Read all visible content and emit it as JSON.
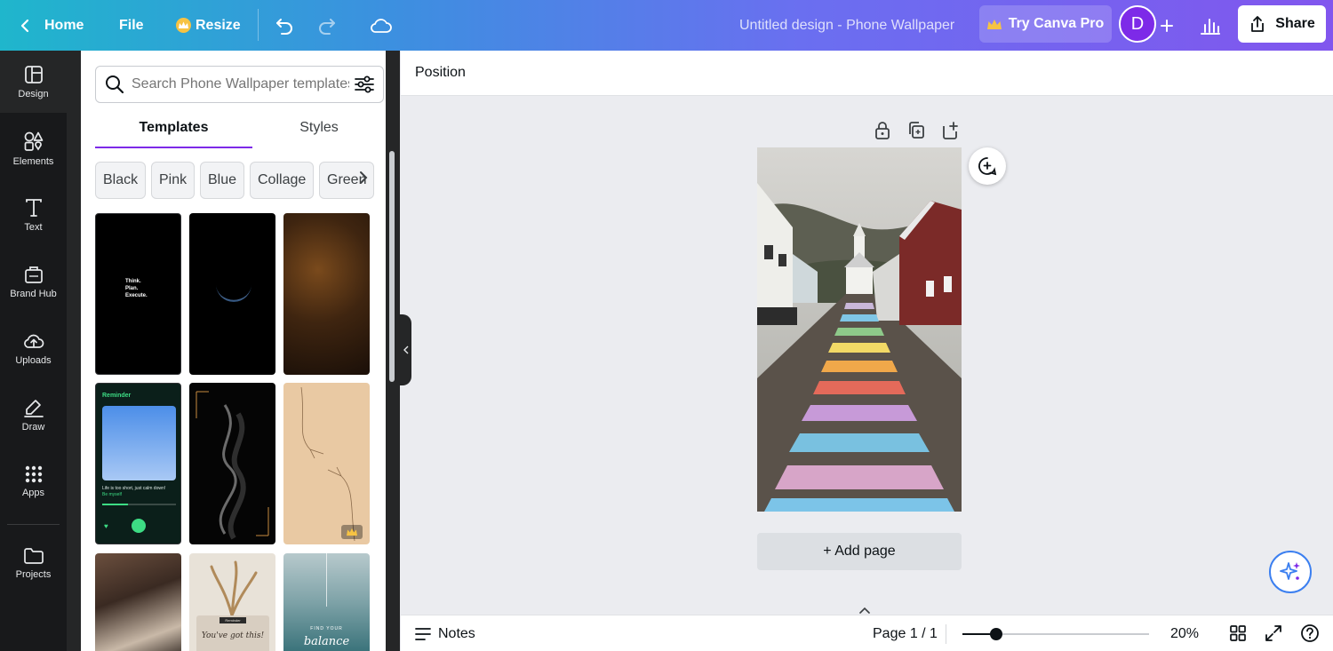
{
  "topbar": {
    "home_label": "Home",
    "file_label": "File",
    "resize_label": "Resize",
    "design_title": "Untitled design - Phone Wallpaper",
    "try_pro_label": "Try Canva Pro",
    "avatar_initial": "D",
    "share_label": "Share"
  },
  "rail": {
    "items": [
      {
        "label": "Design",
        "icon": "layout-icon"
      },
      {
        "label": "Elements",
        "icon": "shapes-icon"
      },
      {
        "label": "Text",
        "icon": "text-icon"
      },
      {
        "label": "Brand Hub",
        "icon": "brand-icon"
      },
      {
        "label": "Uploads",
        "icon": "upload-cloud-icon"
      },
      {
        "label": "Draw",
        "icon": "draw-icon"
      },
      {
        "label": "Apps",
        "icon": "apps-grid-icon"
      },
      {
        "label": "Projects",
        "icon": "folder-icon"
      }
    ]
  },
  "panel": {
    "search_placeholder": "Search Phone Wallpaper templates",
    "tabs": [
      {
        "label": "Templates"
      },
      {
        "label": "Styles"
      }
    ],
    "chips": [
      "Black",
      "Pink",
      "Blue",
      "Collage",
      "Green"
    ],
    "templates": [
      {
        "text": "Think.\nPlan.\nExecute."
      },
      {
        "text": ""
      },
      {
        "text": ""
      },
      {
        "text": "Reminder"
      },
      {
        "text": ""
      },
      {
        "text": ""
      },
      {
        "text": ""
      },
      {
        "text": "You've got this!"
      },
      {
        "text": "FIND YOUR balance"
      }
    ],
    "reminder_caption": "Life is too short, just calm down!",
    "reminder_sub": "Be myself",
    "retro_label": "Reminder",
    "balance_top": "FIND YOUR",
    "balance_bottom": "balance"
  },
  "canvas": {
    "position_label": "Position",
    "add_page_label": "+ Add page"
  },
  "bottombar": {
    "notes_label": "Notes",
    "page_indicator": "Page 1 / 1",
    "zoom_level": "20%",
    "zoom_fraction": 0.18
  },
  "colors": {
    "accent": "#7d2ae8",
    "rail_bg": "#18191b",
    "canvas_bg": "#ebecf0"
  }
}
